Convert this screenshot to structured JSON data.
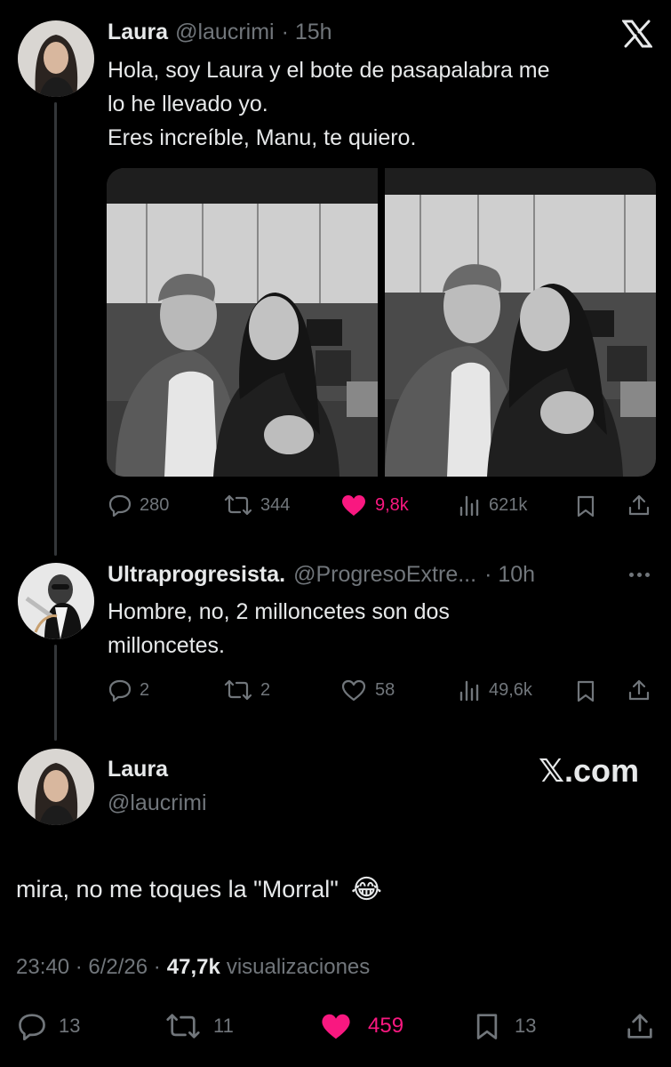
{
  "tweet1": {
    "name": "Laura",
    "handle": "@laucrimi",
    "time": "· 15h",
    "text_lines": [
      "Hola, soy Laura y el bote de pasapalabra me",
      "lo he llevado yo.",
      "Eres increíble, Manu, te quiero."
    ],
    "stats": {
      "replies": "280",
      "retweets": "344",
      "likes": "9,8k",
      "views": "621k"
    },
    "brand_icon": "x-logo-icon"
  },
  "tweet2": {
    "name": "Ultraprogresista.",
    "handle": "@ProgresoExtre...",
    "time": "· 10h",
    "text_lines": [
      "Hombre, no, 2 milloncetes son dos",
      "milloncetes."
    ],
    "stats": {
      "replies": "2",
      "retweets": "2",
      "likes": "58",
      "views": "49,6k"
    }
  },
  "tweet3": {
    "name": "Laura",
    "handle": "@laucrimi",
    "brand": "𝕏.com",
    "text": "mira, no me toques la \"Morral\"",
    "emoji": "😂",
    "meta_time": "23:40 · 6/2/26 ·",
    "meta_views_count": "47,7k",
    "meta_views_label": "visualizaciones",
    "stats": {
      "replies": "13",
      "retweets": "11",
      "likes": "459",
      "bookmarks": "13"
    }
  },
  "colors": {
    "background": "#000000",
    "text": "#e7e9ea",
    "muted": "#71767b",
    "like": "#f91880",
    "line": "#333639"
  }
}
